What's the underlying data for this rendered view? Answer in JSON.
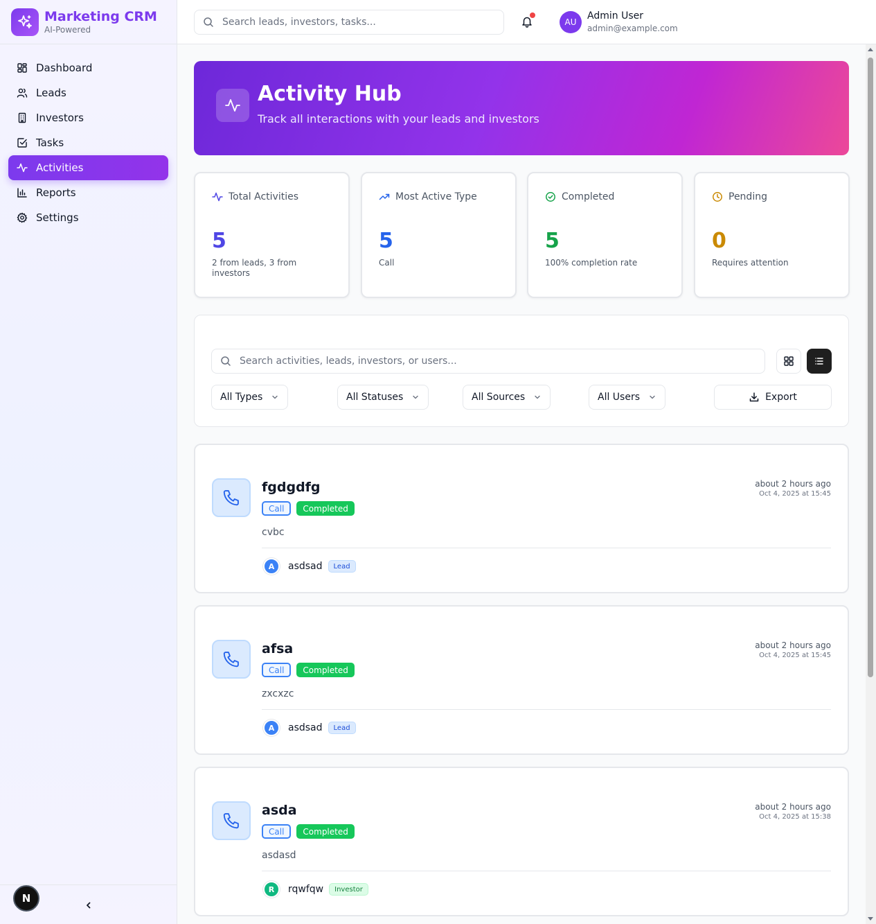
{
  "brand": {
    "title": "Marketing CRM",
    "subtitle": "AI-Powered"
  },
  "sidebar": {
    "items": [
      {
        "label": "Dashboard",
        "icon": "dashboard-icon"
      },
      {
        "label": "Leads",
        "icon": "users-icon"
      },
      {
        "label": "Investors",
        "icon": "building-icon"
      },
      {
        "label": "Tasks",
        "icon": "checkbox-icon"
      },
      {
        "label": "Activities",
        "icon": "activity-icon",
        "active": true
      },
      {
        "label": "Reports",
        "icon": "bar-chart-icon"
      },
      {
        "label": "Settings",
        "icon": "gear-icon"
      }
    ],
    "footer_badge": "N"
  },
  "header": {
    "search_placeholder": "Search leads, investors, tasks...",
    "user": {
      "initials": "AU",
      "name": "Admin User",
      "email": "admin@example.com"
    }
  },
  "hero": {
    "title": "Activity Hub",
    "subtitle": "Track all interactions with your leads and investors"
  },
  "stats": [
    {
      "label": "Total Activities",
      "value": "5",
      "desc": "2 from leads, 3 from investors",
      "color": "#4f46e5"
    },
    {
      "label": "Most Active Type",
      "value": "5",
      "desc": "Call",
      "color": "#2563eb"
    },
    {
      "label": "Completed",
      "value": "5",
      "desc": "100% completion rate",
      "color": "#16a34a"
    },
    {
      "label": "Pending",
      "value": "0",
      "desc": "Requires attention",
      "color": "#ca8a04"
    }
  ],
  "filters": {
    "search_placeholder": "Search activities, leads, investors, or users...",
    "types": "All Types",
    "statuses": "All Statuses",
    "sources": "All Sources",
    "users": "All Users",
    "export_label": "Export"
  },
  "activities": [
    {
      "title": "fgdgdfg",
      "type": "Call",
      "status": "Completed",
      "description": "cvbc",
      "owner_initial": "A",
      "owner_name": "asdsad",
      "owner_tag": "Lead",
      "time_relative": "about 2 hours ago",
      "time_absolute": "Oct 4, 2025 at 15:45"
    },
    {
      "title": "afsa",
      "type": "Call",
      "status": "Completed",
      "description": "zxcxzc",
      "owner_initial": "A",
      "owner_name": "asdsad",
      "owner_tag": "Lead",
      "time_relative": "about 2 hours ago",
      "time_absolute": "Oct 4, 2025 at 15:45"
    },
    {
      "title": "asda",
      "type": "Call",
      "status": "Completed",
      "description": "asdasd",
      "owner_initial": "R",
      "owner_name": "rqwfqw",
      "owner_tag": "Investor",
      "time_relative": "about 2 hours ago",
      "time_absolute": "Oct 4, 2025 at 15:38"
    }
  ],
  "colors": {
    "accent": "#7c3aed",
    "lead_avatar": "#3b82f6",
    "investor_avatar": "#10b981",
    "status_completed": "#16c75a"
  }
}
